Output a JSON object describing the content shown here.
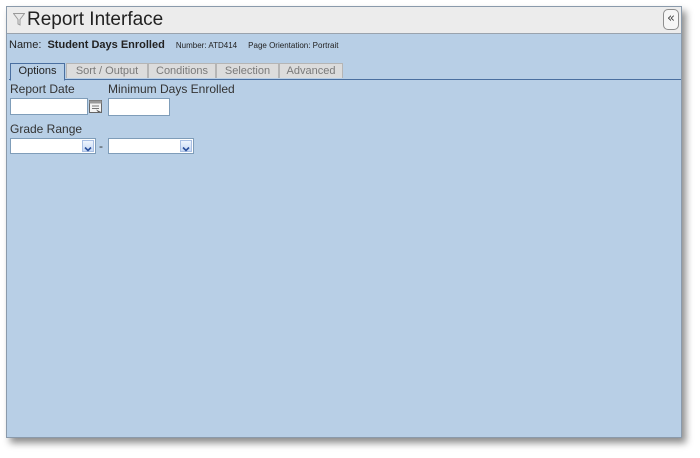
{
  "window": {
    "title": "Report Interface",
    "collapse_glyph": "«"
  },
  "report": {
    "name_label": "Name:",
    "name_value": "Student Days Enrolled",
    "number_text": "Number: ATD414",
    "orientation_text": "Page Orientation: Portrait"
  },
  "tabs": [
    {
      "label": "Options",
      "active": true
    },
    {
      "label": "Sort / Output",
      "active": false
    },
    {
      "label": "Conditions",
      "active": false
    },
    {
      "label": "Selection",
      "active": false
    },
    {
      "label": "Advanced",
      "active": false
    }
  ],
  "options": {
    "report_date_label": "Report Date",
    "report_date_value": "",
    "min_days_label": "Minimum Days Enrolled",
    "min_days_value": "",
    "grade_range_label": "Grade Range",
    "grade_from_value": "",
    "grade_to_value": "",
    "range_separator": "-"
  },
  "icons": {
    "filter": "filter-icon",
    "calendar": "calendar-icon",
    "collapse": "double-chevron-left-icon",
    "dropdown": "chevron-down-icon"
  },
  "colors": {
    "panel_bg": "#b8cfe6",
    "titlebar_bg": "#ececec",
    "tab_border": "#4a6fa0"
  }
}
